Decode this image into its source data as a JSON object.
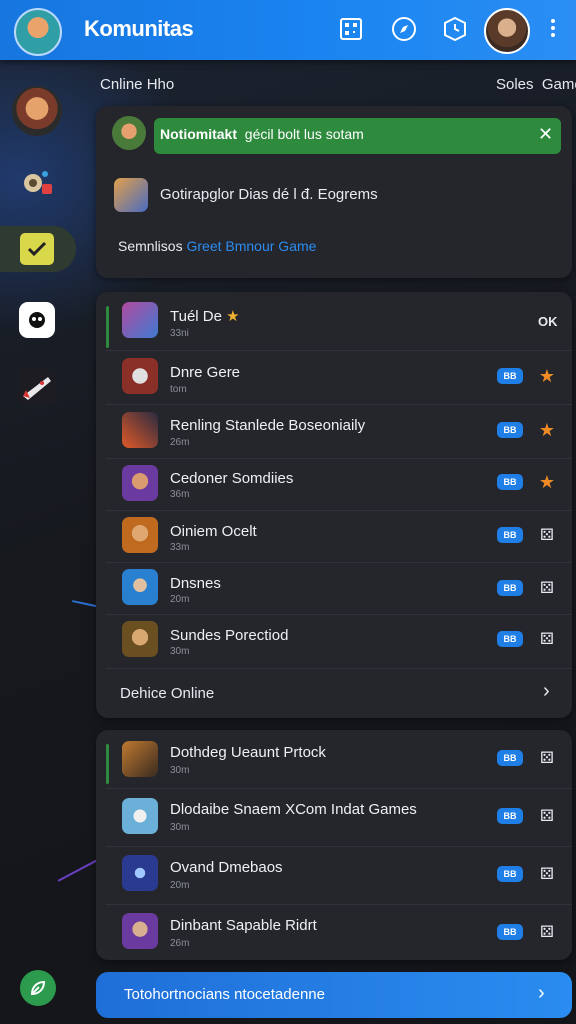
{
  "header": {
    "brand": "Komunitas",
    "icons": [
      "qr-code-icon",
      "compass-icon",
      "clock-icon"
    ]
  },
  "sidebar": {
    "items": [
      "player-avatar",
      "gift-icon",
      "check-badge-icon",
      "discord-icon",
      "spaceship-icon"
    ]
  },
  "section": {
    "left_label": "Cnline Hho",
    "right_label": "Soles  Game"
  },
  "notifications": {
    "banner_title": "Notiomitakt",
    "banner_text": "gécil bolt lus sotam",
    "line1": "Gotirapglor Dias dé l đ. Eogrems",
    "line2_prefix": "Semnlisos",
    "line2_link": "Greet Bmnour Game"
  },
  "games_card1": {
    "rows": [
      {
        "title": "Tuél De",
        "sub": "33ni",
        "badge": "",
        "icon": "ok"
      },
      {
        "title": "Dnre Gere",
        "sub": "tom",
        "badge": "BB",
        "icon": "star"
      },
      {
        "title": "Renling Stanlede Boseoniaily",
        "sub": "26m",
        "badge": "BB",
        "icon": "star"
      },
      {
        "title": "Cedoner Somdiies",
        "sub": "36m",
        "badge": "BB",
        "icon": "star"
      },
      {
        "title": "Oiniem Ocelt",
        "sub": "33m",
        "badge": "BB",
        "icon": "dice"
      },
      {
        "title": "Dnsnes",
        "sub": "20m",
        "badge": "BB",
        "icon": "dice"
      },
      {
        "title": "Sundes Porectiod",
        "sub": "30m",
        "badge": "BB",
        "icon": "dice"
      }
    ],
    "ok_label": "OK",
    "more_label": "Dehice Online"
  },
  "games_card2": {
    "rows": [
      {
        "title": "Dothdeg Ueaunt Prtock",
        "sub": "30m",
        "badge": "BB",
        "icon": "dice"
      },
      {
        "title": "Dlodaibe Snaem XCom Indat Games",
        "sub": "30m",
        "badge": "BB",
        "icon": "dice"
      },
      {
        "title": "Ovand Dmebaos",
        "sub": "20m",
        "badge": "BB",
        "icon": "dice"
      },
      {
        "title": "Dinbant Sapable Ridrt",
        "sub": "26m",
        "badge": "BB",
        "icon": "dice"
      }
    ]
  },
  "cta": {
    "label": "Totohortnocians ntocetadenne"
  },
  "colors": {
    "accent_blue": "#1a84f0",
    "banner_green": "#2e8b3e",
    "star_orange": "#f08a24"
  }
}
